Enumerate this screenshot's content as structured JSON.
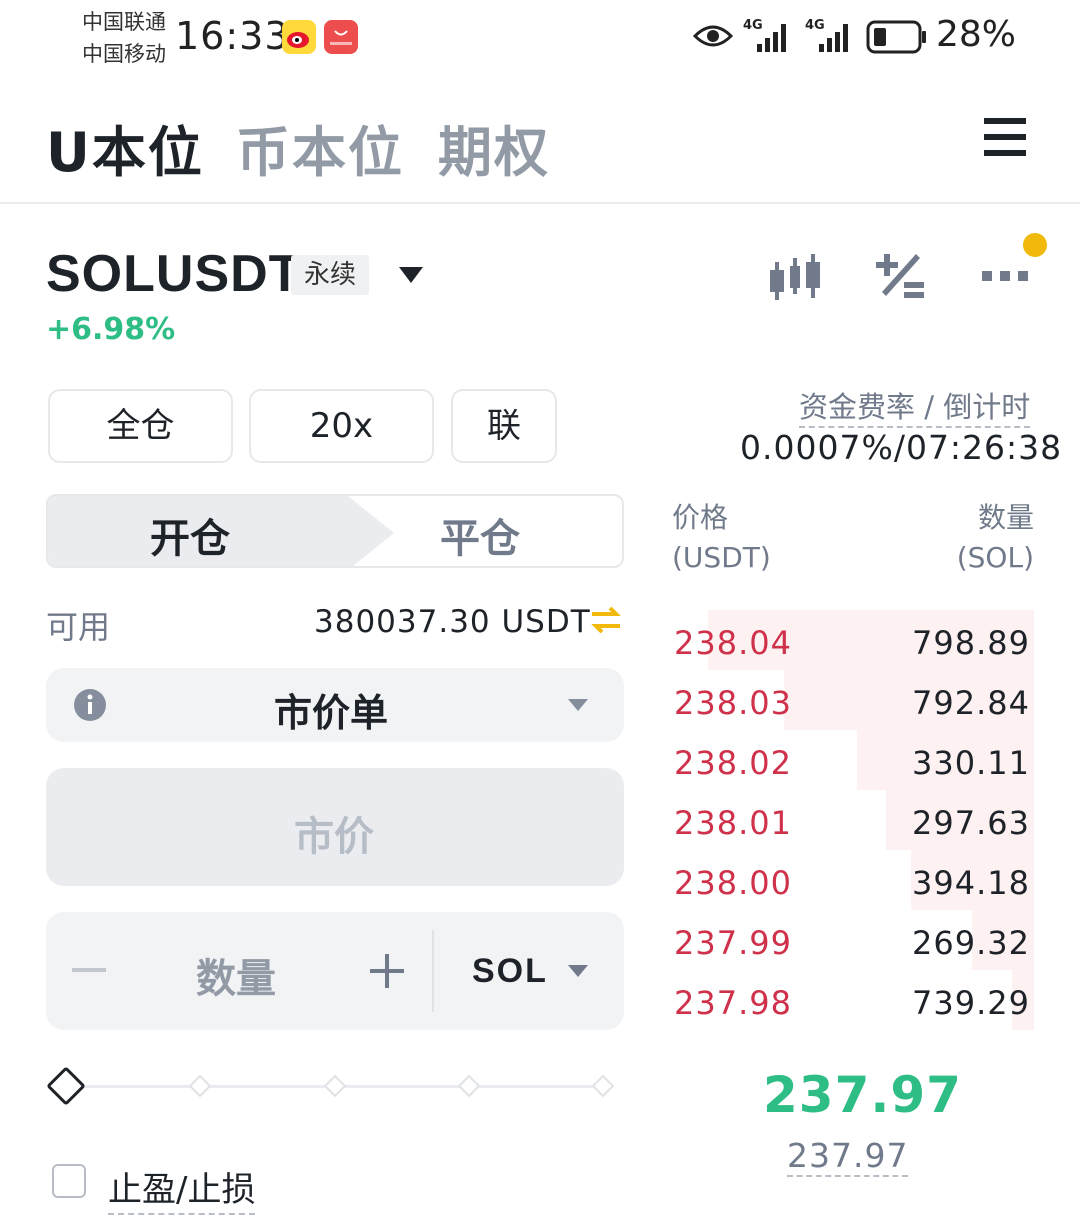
{
  "status_bar": {
    "carrier_1": "中国联通",
    "carrier_2": "中国移动",
    "time": "16:33",
    "signal_1": "4G",
    "signal_2": "4G",
    "battery": "28%"
  },
  "top_tabs": [
    {
      "label": "U本位",
      "active": true
    },
    {
      "label": "币本位",
      "active": false
    },
    {
      "label": "期权",
      "active": false
    }
  ],
  "symbol": {
    "name": "SOLUSDT",
    "type_tag": "永续",
    "change": "+6.98%"
  },
  "margin": {
    "mode": "全仓",
    "leverage": "20x",
    "asset_mode": "联"
  },
  "order_side": {
    "open": "开仓",
    "close": "平仓"
  },
  "available": {
    "label": "可用",
    "value": "380037.30 USDT"
  },
  "order_type": {
    "selected": "市价单"
  },
  "price_field": {
    "placeholder": "市价"
  },
  "quantity_field": {
    "placeholder": "数量",
    "unit": "SOL"
  },
  "slider": {
    "level": 0
  },
  "tpsl": {
    "label": "止盈/止损",
    "checked": false
  },
  "funding": {
    "label": "资金费率 / 倒计时",
    "value": "0.0007%/07:26:38"
  },
  "orderbook": {
    "price_header": "价格",
    "price_unit": "(USDT)",
    "qty_header": "数量",
    "qty_unit": "(SOL)",
    "asks": [
      {
        "price": "238.04",
        "qty": "798.89",
        "depth": 0.9
      },
      {
        "price": "238.03",
        "qty": "792.84",
        "depth": 0.69
      },
      {
        "price": "238.02",
        "qty": "330.11",
        "depth": 0.49
      },
      {
        "price": "238.01",
        "qty": "297.63",
        "depth": 0.41
      },
      {
        "price": "238.00",
        "qty": "394.18",
        "depth": 0.34
      },
      {
        "price": "237.99",
        "qty": "269.32",
        "depth": 0.17
      },
      {
        "price": "237.98",
        "qty": "739.29",
        "depth": 0.06
      }
    ],
    "last_price": "237.97",
    "mark_price": "237.97"
  },
  "colors": {
    "up": "#2ebd85",
    "down": "#cf304a",
    "accent": "#f0b90b"
  }
}
